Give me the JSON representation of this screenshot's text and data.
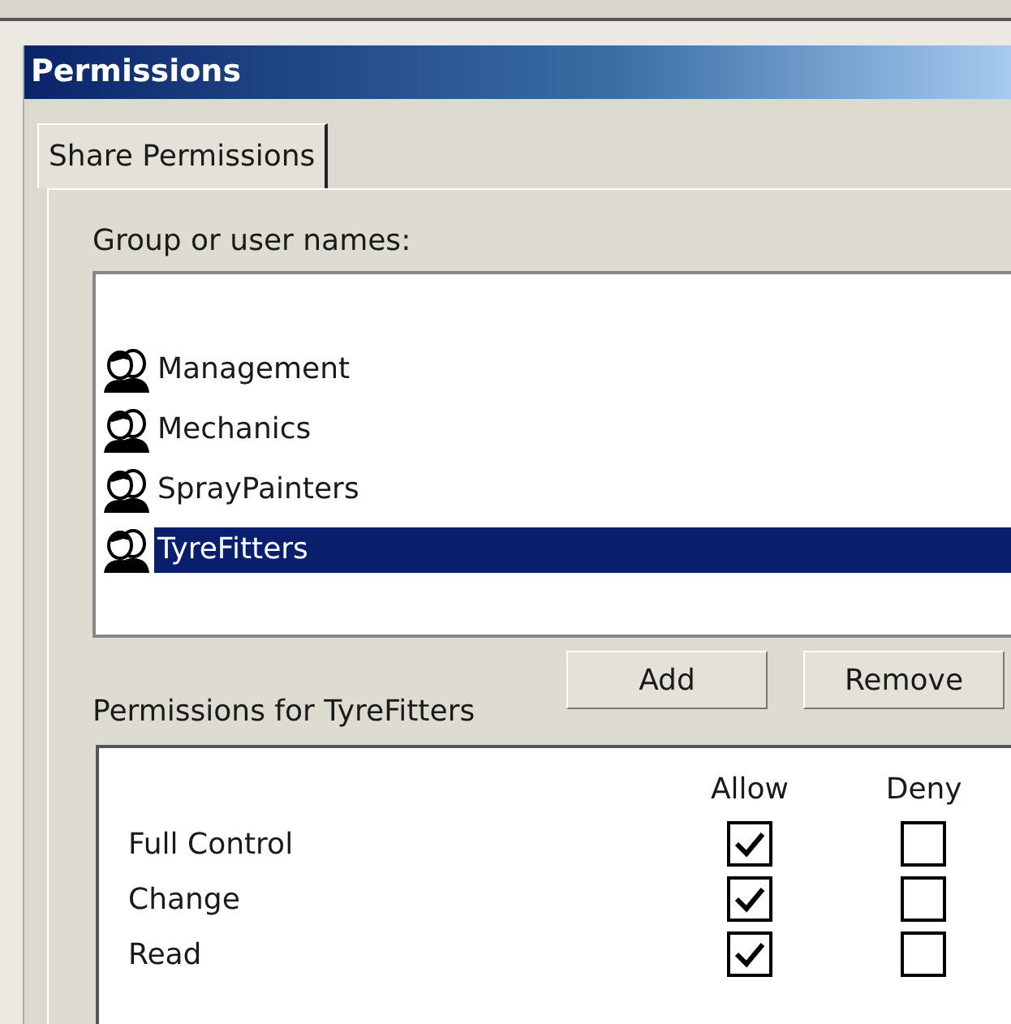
{
  "window": {
    "title": "Permissions"
  },
  "tabs": [
    {
      "label": "Share Permissions",
      "selected": true
    }
  ],
  "groups_label": "Group or user names:",
  "groups": [
    {
      "name": "Management",
      "selected": false
    },
    {
      "name": "Mechanics",
      "selected": false
    },
    {
      "name": "SprayPainters",
      "selected": false
    },
    {
      "name": "TyreFitters",
      "selected": true
    }
  ],
  "buttons": [
    "Add",
    "Remove"
  ],
  "permissions_label": "Permissions for TyreFitters",
  "columns": [
    "Allow",
    "Deny"
  ],
  "permissions": [
    {
      "name": "Full Control",
      "allow": true,
      "deny": false
    },
    {
      "name": "Change",
      "allow": true,
      "deny": false
    },
    {
      "name": "Read",
      "allow": true,
      "deny": false
    }
  ]
}
